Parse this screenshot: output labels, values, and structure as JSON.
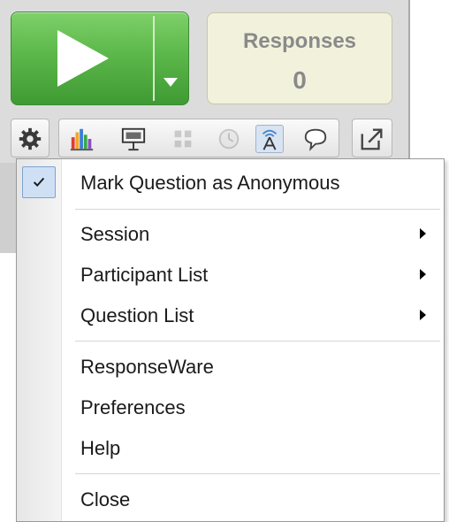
{
  "responses": {
    "label": "Responses",
    "count": "0"
  },
  "toolbar": {
    "settings_icon": "gear-icon",
    "group_icons": [
      "bar-chart-icon",
      "presenter-icon",
      "grid-icon",
      "clock-icon",
      "wireless-icon",
      "speech-bubble-icon"
    ],
    "share_icon": "share-export-icon"
  },
  "menu": {
    "items": [
      {
        "label": "Mark Question as Anonymous",
        "checked": true
      },
      {
        "label": "Session",
        "submenu": true
      },
      {
        "label": "Participant List",
        "submenu": true
      },
      {
        "label": "Question List",
        "submenu": true
      },
      {
        "label": "ResponseWare"
      },
      {
        "label": "Preferences"
      },
      {
        "label": "Help"
      },
      {
        "label": "Close"
      }
    ]
  },
  "colors": {
    "play_green": "#5cb84a",
    "responses_bg": "#f2f2dc",
    "highlight": "#cfe0f5"
  }
}
